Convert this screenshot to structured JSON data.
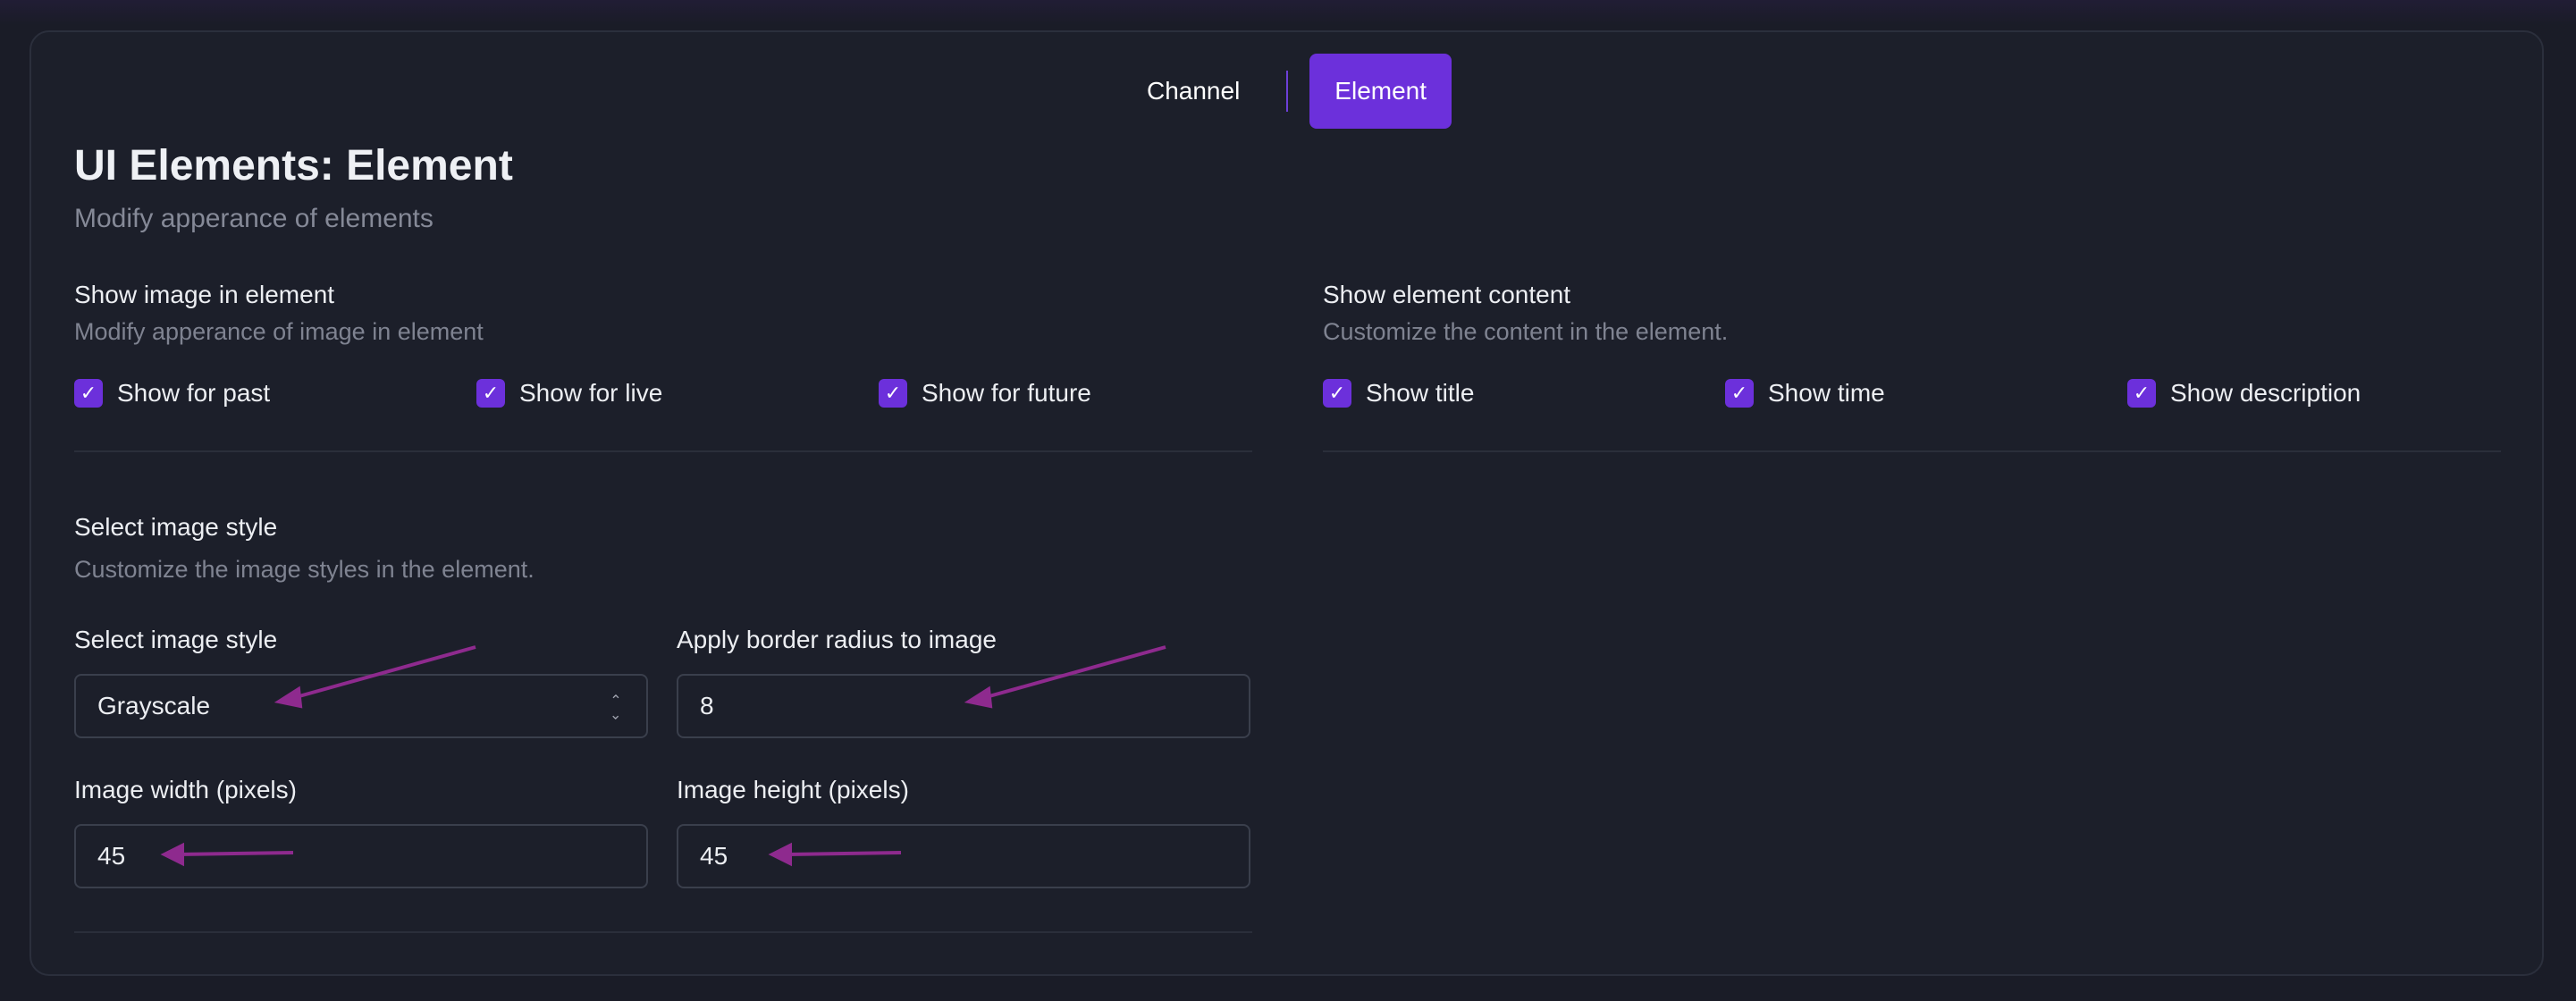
{
  "tabs": [
    {
      "label": "Channel",
      "active": false
    },
    {
      "label": "Element",
      "active": true
    }
  ],
  "page": {
    "title": "UI Elements: Element",
    "subtitle": "Modify apperance of elements"
  },
  "image_section": {
    "heading": "Show image in element",
    "description": "Modify apperance of image in element",
    "options": [
      {
        "label": "Show for past",
        "checked": true
      },
      {
        "label": "Show for live",
        "checked": true
      },
      {
        "label": "Show for future",
        "checked": true
      }
    ]
  },
  "content_section": {
    "heading": "Show element content",
    "description": "Customize the content in the element.",
    "options": [
      {
        "label": "Show title",
        "checked": true
      },
      {
        "label": "Show time",
        "checked": true
      },
      {
        "label": "Show description",
        "checked": true
      }
    ]
  },
  "style_section": {
    "heading": "Select image style",
    "description": "Customize the image styles in the element.",
    "fields": {
      "image_style": {
        "label": "Select image style",
        "value": "Grayscale"
      },
      "border_radius": {
        "label": "Apply border radius to image",
        "value": "8"
      },
      "image_width": {
        "label": "Image width (pixels)",
        "value": "45"
      },
      "image_height": {
        "label": "Image height (pixels)",
        "value": "45"
      }
    }
  },
  "icons": {
    "checkbox": "check-icon",
    "select": "chevron-up-down-icon"
  },
  "colors": {
    "accent": "#6c30db",
    "annotation_arrow": "#8e2a8e",
    "panel_bg": "#1c1f2a"
  }
}
